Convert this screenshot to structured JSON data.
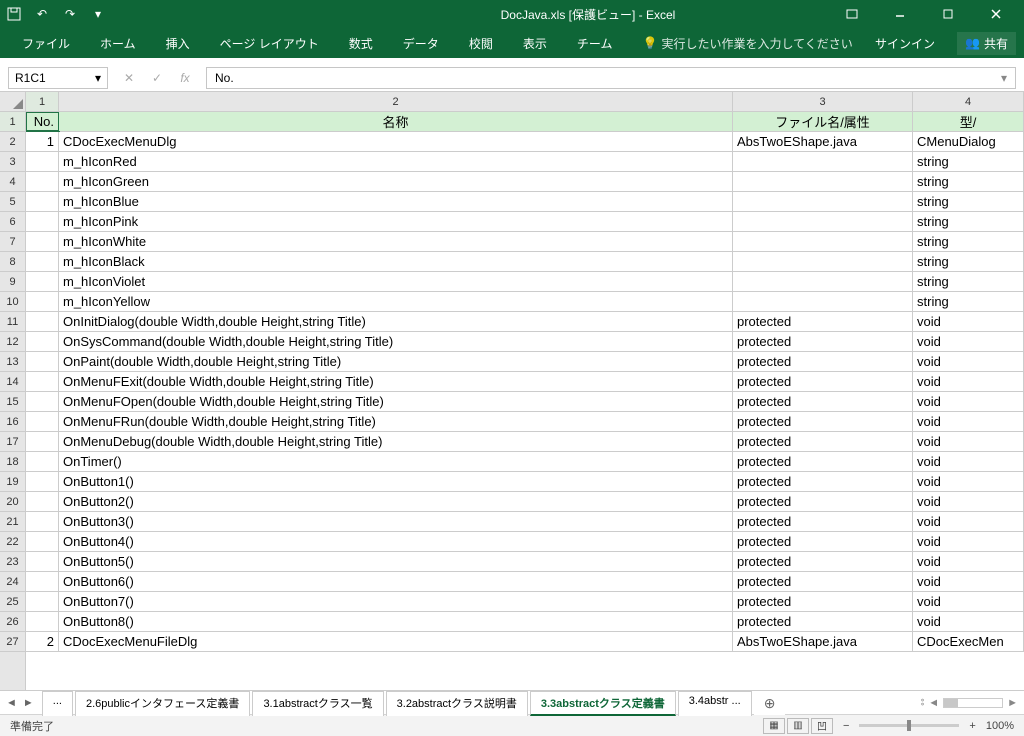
{
  "title": "DocJava.xls  [保護ビュー] - Excel",
  "qat": {
    "undo": "↶",
    "redo": "↷"
  },
  "tabs": [
    "ファイル",
    "ホーム",
    "挿入",
    "ページ レイアウト",
    "数式",
    "データ",
    "校閲",
    "表示",
    "チーム"
  ],
  "tellme": "実行したい作業を入力してください",
  "signin": "サインイン",
  "share": "共有",
  "name_box": "R1C1",
  "formula": "No.",
  "col_nums": [
    "1",
    "2",
    "3",
    "4"
  ],
  "headers": {
    "c1": "No.",
    "c2": "名称",
    "c3": "ファイル名/属性",
    "c4": "型/"
  },
  "rows": [
    {
      "n": "1",
      "name": "CDocExecMenuDlg",
      "attr": "AbsTwoEShape.java",
      "type": "CMenuDialog"
    },
    {
      "n": "",
      "name": "m_hIconRed",
      "attr": "",
      "type": "string"
    },
    {
      "n": "",
      "name": "m_hIconGreen",
      "attr": "",
      "type": "string"
    },
    {
      "n": "",
      "name": "m_hIconBlue",
      "attr": "",
      "type": "string"
    },
    {
      "n": "",
      "name": "m_hIconPink",
      "attr": "",
      "type": "string"
    },
    {
      "n": "",
      "name": "m_hIconWhite",
      "attr": "",
      "type": "string"
    },
    {
      "n": "",
      "name": "m_hIconBlack",
      "attr": "",
      "type": "string"
    },
    {
      "n": "",
      "name": "m_hIconViolet",
      "attr": "",
      "type": "string"
    },
    {
      "n": "",
      "name": "m_hIconYellow",
      "attr": "",
      "type": "string"
    },
    {
      "n": "",
      "name": "OnInitDialog(double Width,double Height,string Title)",
      "attr": "protected",
      "type": "void"
    },
    {
      "n": "",
      "name": "OnSysCommand(double Width,double Height,string Title)",
      "attr": "protected",
      "type": "void"
    },
    {
      "n": "",
      "name": "OnPaint(double Width,double Height,string Title)",
      "attr": "protected",
      "type": "void"
    },
    {
      "n": "",
      "name": "OnMenuFExit(double Width,double Height,string Title)",
      "attr": "protected",
      "type": "void"
    },
    {
      "n": "",
      "name": "OnMenuFOpen(double Width,double Height,string Title)",
      "attr": "protected",
      "type": "void"
    },
    {
      "n": "",
      "name": "OnMenuFRun(double Width,double Height,string Title)",
      "attr": "protected",
      "type": "void"
    },
    {
      "n": "",
      "name": "OnMenuDebug(double Width,double Height,string Title)",
      "attr": "protected",
      "type": "void"
    },
    {
      "n": "",
      "name": "OnTimer()",
      "attr": "protected",
      "type": "void"
    },
    {
      "n": "",
      "name": "OnButton1()",
      "attr": "protected",
      "type": "void"
    },
    {
      "n": "",
      "name": "OnButton2()",
      "attr": "protected",
      "type": "void"
    },
    {
      "n": "",
      "name": "OnButton3()",
      "attr": "protected",
      "type": "void"
    },
    {
      "n": "",
      "name": "OnButton4()",
      "attr": "protected",
      "type": "void"
    },
    {
      "n": "",
      "name": "OnButton5()",
      "attr": "protected",
      "type": "void"
    },
    {
      "n": "",
      "name": "OnButton6()",
      "attr": "protected",
      "type": "void"
    },
    {
      "n": "",
      "name": "OnButton7()",
      "attr": "protected",
      "type": "void"
    },
    {
      "n": "",
      "name": "OnButton8()",
      "attr": "protected",
      "type": "void"
    },
    {
      "n": "2",
      "name": "CDocExecMenuFileDlg",
      "attr": "AbsTwoEShape.java",
      "type": "CDocExecMen"
    }
  ],
  "sheets": {
    "list": [
      "...",
      "2.6publicインタフェース定義書",
      "3.1abstractクラス一覧",
      "3.2abstractクラス説明書",
      "3.3abstractクラス定義書",
      "3.4abstr ..."
    ],
    "active": 4
  },
  "status": "準備完了",
  "zoom": "100%"
}
